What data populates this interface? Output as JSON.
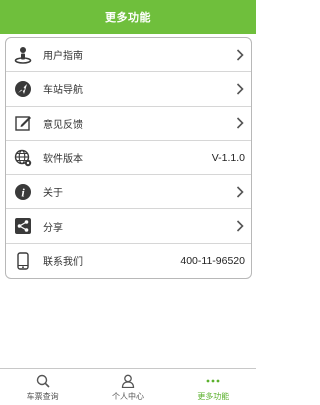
{
  "header": {
    "title": "更多功能"
  },
  "menu": {
    "items": [
      {
        "label": "用户指南",
        "icon": "user-guide-icon"
      },
      {
        "label": "车站导航",
        "icon": "station-nav-icon"
      },
      {
        "label": "意见反馈",
        "icon": "feedback-icon"
      },
      {
        "label": "软件版本",
        "icon": "globe-icon",
        "value": "V-1.1.0"
      },
      {
        "label": "关于",
        "icon": "info-icon"
      },
      {
        "label": "分享",
        "icon": "share-icon"
      },
      {
        "label": "联系我们",
        "icon": "phone-icon",
        "value": "400-11-96520"
      }
    ]
  },
  "tabbar": {
    "tabs": [
      {
        "label": "车票查询",
        "icon": "search-icon"
      },
      {
        "label": "个人中心",
        "icon": "person-icon"
      },
      {
        "label": "更多功能",
        "icon": "more-icon",
        "active": true
      }
    ]
  },
  "colors": {
    "accent": "#6fbf3c",
    "active_tab": "#5bb12c",
    "icon_dark": "#3a3a3a"
  }
}
